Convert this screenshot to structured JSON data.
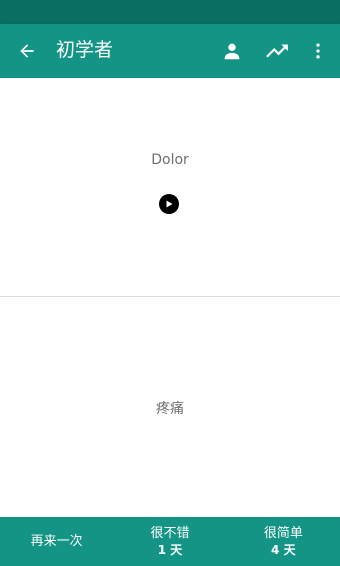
{
  "app": {
    "title": "初学者",
    "accent_color": "#139484",
    "status_bar_color": "#0a6f63"
  },
  "toolbar": {
    "back_icon": "arrow-left-icon",
    "person_icon": "person-icon",
    "stats_icon": "trending-up-icon",
    "more_icon": "more-vertical-icon"
  },
  "card": {
    "front_text": "Dolor",
    "audio_icon": "play-icon",
    "back_text": "疼痛"
  },
  "answers": [
    {
      "label": "再来一次",
      "interval": ""
    },
    {
      "label": "很不错",
      "interval": "1 天"
    },
    {
      "label": "很简单",
      "interval": "4 天"
    }
  ]
}
